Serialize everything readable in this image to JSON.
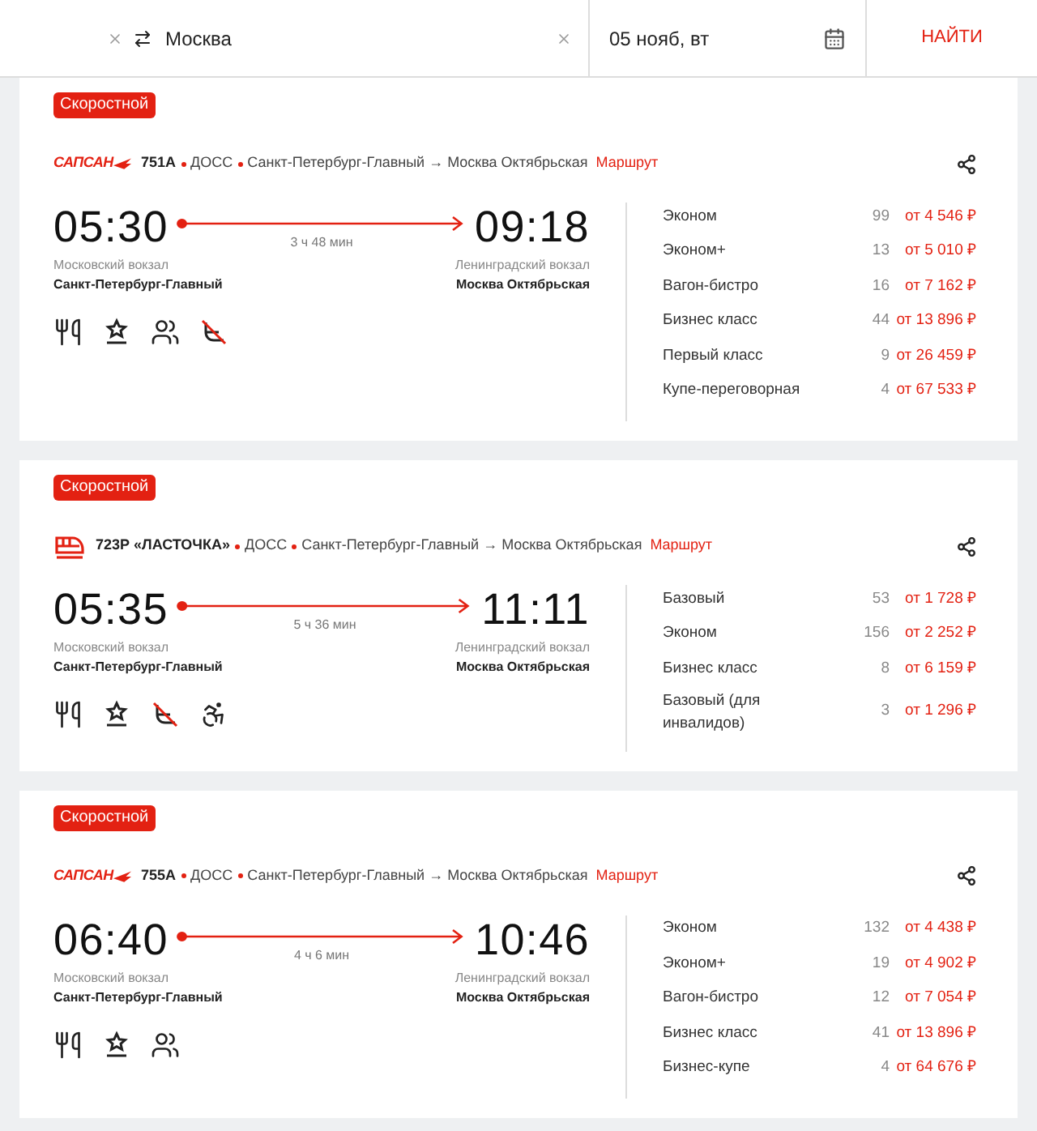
{
  "search": {
    "to": "Москва",
    "date": "05 нояб, вт",
    "button": "НАЙТИ"
  },
  "trains": [
    {
      "badge": "Скоростной",
      "kind": "sapsan",
      "logo_text": "САПСАН",
      "number": "751А",
      "carrier": "ДОСС",
      "route": "Санкт-Петербург-Главный → Москва Октябрьская",
      "route_link": "Маршрут",
      "depart_time": "05:30",
      "arrive_time": "09:18",
      "duration": "3 ч 48 мин",
      "depart_station": "Московский вокзал",
      "depart_city": "Санкт-Петербург-Главный",
      "arrive_station": "Ленинградский вокзал",
      "arrive_city": "Москва Октябрьская",
      "amenities": [
        {
          "kind": "food"
        },
        {
          "kind": "award"
        },
        {
          "kind": "group"
        },
        {
          "kind": "crossed"
        }
      ],
      "classes": [
        {
          "name": "Эконом",
          "seats": "99",
          "price": "от 4 546 ₽"
        },
        {
          "name": "Эконом+",
          "seats": "13",
          "price": "от 5 010 ₽"
        },
        {
          "name": "Вагон-бистро",
          "seats": "16",
          "price": "от 7 162 ₽"
        },
        {
          "name": "Бизнес класс",
          "seats": "44",
          "price": "от 13 896 ₽"
        },
        {
          "name": "Первый класс",
          "seats": "9",
          "price": "от 26 459 ₽"
        },
        {
          "name": "Купе-переговорная",
          "seats": "4",
          "price": "от 67 533 ₽"
        }
      ]
    },
    {
      "badge": "Скоростной",
      "kind": "lastochka",
      "number": "723Р «ЛАСТОЧКА»",
      "carrier": "ДОСС",
      "route": "Санкт-Петербург-Главный → Москва Октябрьская",
      "route_link": "Маршрут",
      "depart_time": "05:35",
      "arrive_time": "11:11",
      "duration": "5 ч 36 мин",
      "depart_station": "Московский вокзал",
      "depart_city": "Санкт-Петербург-Главный",
      "arrive_station": "Ленинградский вокзал",
      "arrive_city": "Москва Октябрьская",
      "amenities": [
        {
          "kind": "food"
        },
        {
          "kind": "award"
        },
        {
          "kind": "crossed"
        },
        {
          "kind": "wheelchair"
        }
      ],
      "classes": [
        {
          "name": "Базовый",
          "seats": "53",
          "price": "от 1 728 ₽"
        },
        {
          "name": "Эконом",
          "seats": "156",
          "price": "от 2 252 ₽"
        },
        {
          "name": "Бизнес класс",
          "seats": "8",
          "price": "от 6 159 ₽"
        },
        {
          "name": "Базовый (для инвалидов)",
          "seats": "3",
          "price": "от 1 296 ₽"
        }
      ]
    },
    {
      "badge": "Скоростной",
      "kind": "sapsan",
      "logo_text": "САПСАН",
      "number": "755А",
      "carrier": "ДОСС",
      "route": "Санкт-Петербург-Главный → Москва Октябрьская",
      "route_link": "Маршрут",
      "depart_time": "06:40",
      "arrive_time": "10:46",
      "duration": "4 ч 6 мин",
      "depart_station": "Московский вокзал",
      "depart_city": "Санкт-Петербург-Главный",
      "arrive_station": "Ленинградский вокзал",
      "arrive_city": "Москва Октябрьская",
      "amenities": [
        {
          "kind": "food"
        },
        {
          "kind": "award"
        },
        {
          "kind": "group"
        }
      ],
      "classes": [
        {
          "name": "Эконом",
          "seats": "132",
          "price": "от 4 438 ₽"
        },
        {
          "name": "Эконом+",
          "seats": "19",
          "price": "от 4 902 ₽"
        },
        {
          "name": "Вагон-бистро",
          "seats": "12",
          "price": "от 7 054 ₽"
        },
        {
          "name": "Бизнес класс",
          "seats": "41",
          "price": "от 13 896 ₽"
        },
        {
          "name": "Бизнес-купе",
          "seats": "4",
          "price": "от 64 676 ₽"
        }
      ]
    }
  ]
}
